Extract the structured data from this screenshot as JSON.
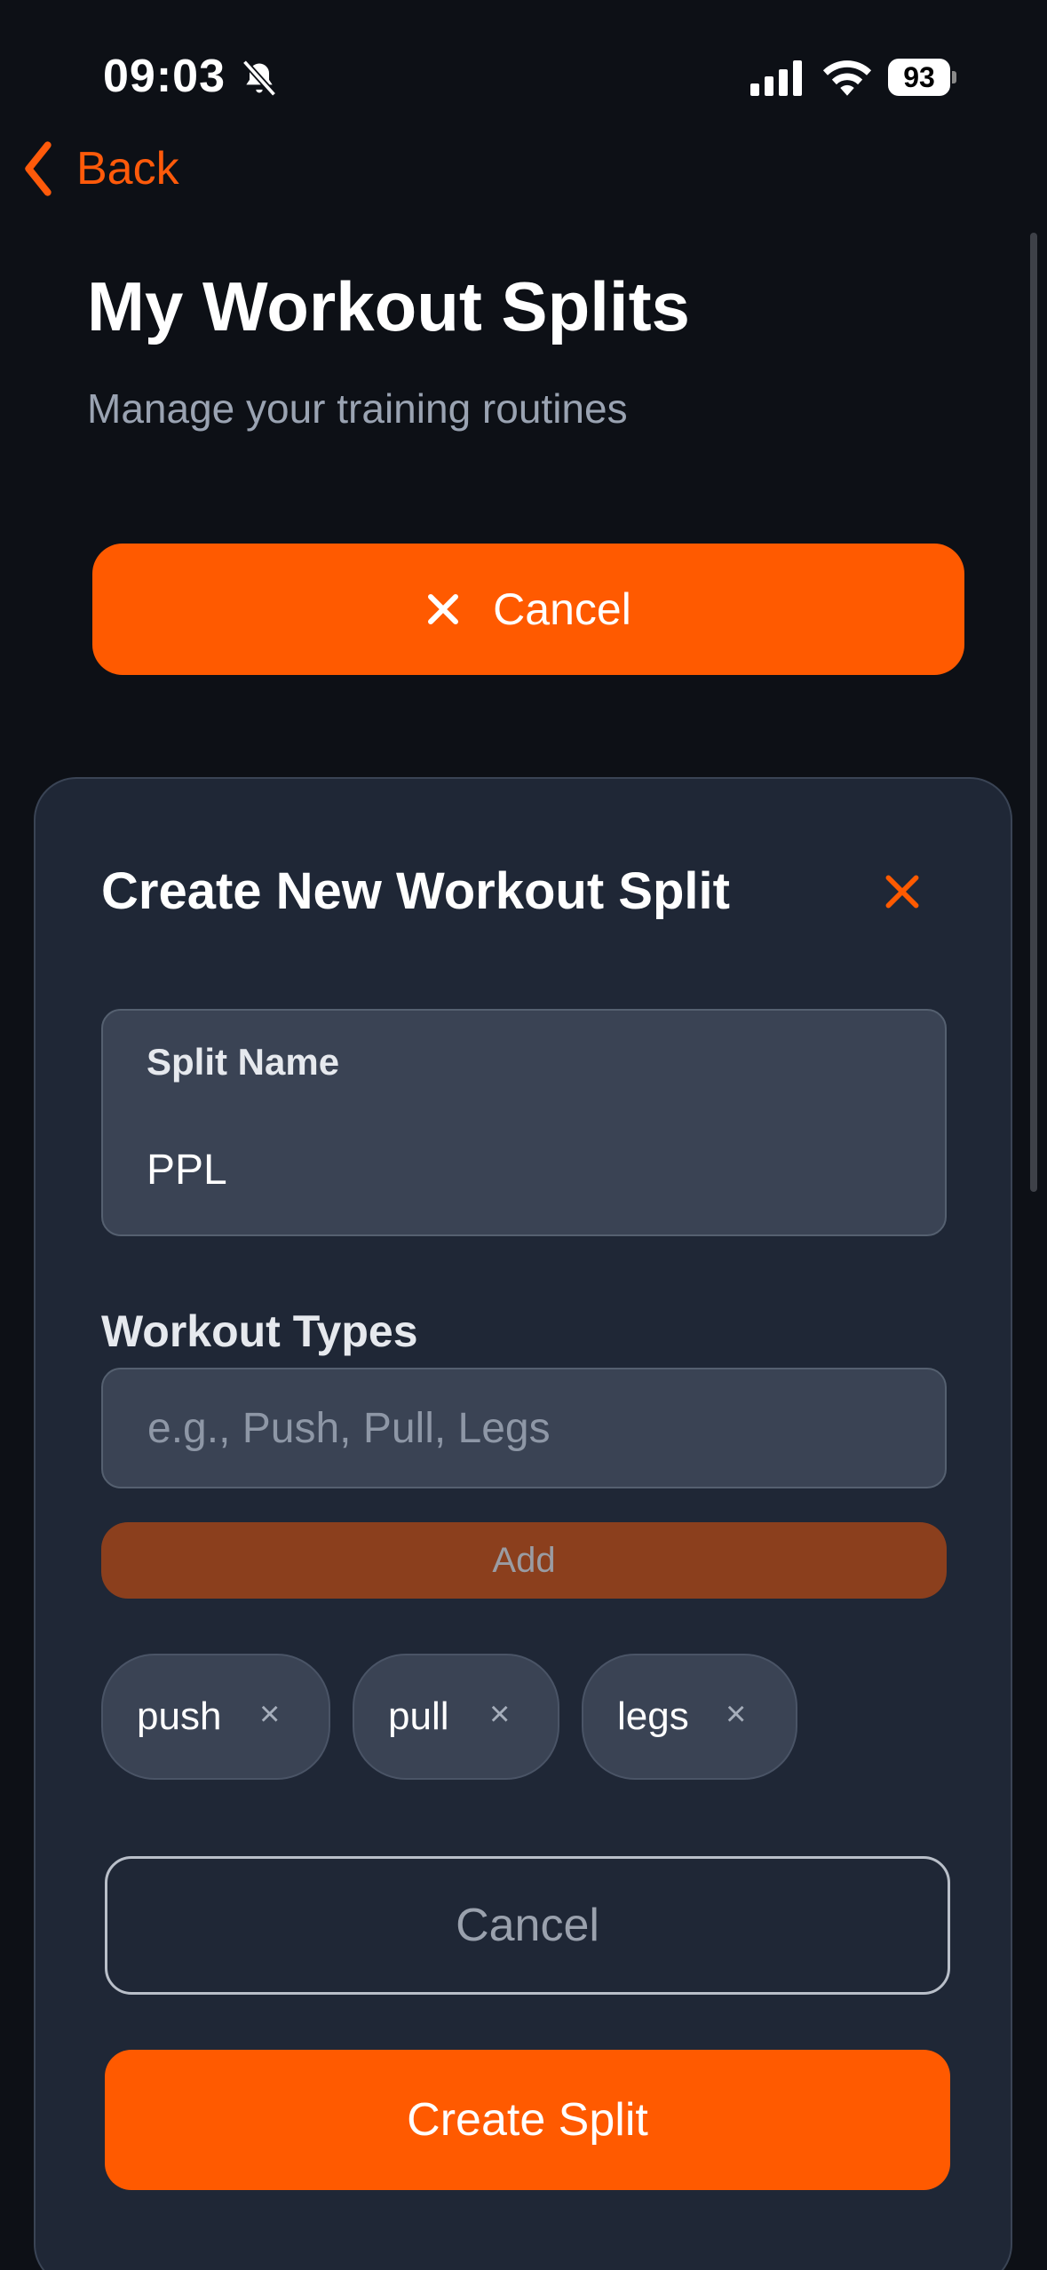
{
  "status_bar": {
    "time": "09:03",
    "battery": "93"
  },
  "nav": {
    "back_label": "Back"
  },
  "header": {
    "title": "My Workout Splits",
    "subtitle": "Manage your training routines"
  },
  "top_cancel_label": "Cancel",
  "form": {
    "title": "Create New Workout Split",
    "split_name_label": "Split Name",
    "split_name_value": "PPL",
    "workout_types_label": "Workout Types",
    "workout_types_placeholder": "e.g., Push, Pull, Legs",
    "add_label": "Add",
    "chips": [
      {
        "label": "push",
        "remove": "×"
      },
      {
        "label": "pull",
        "remove": "×"
      },
      {
        "label": "legs",
        "remove": "×"
      }
    ],
    "cancel_label": "Cancel",
    "create_label": "Create Split"
  },
  "colors": {
    "accent": "#ff5a00",
    "background": "#0d1016",
    "card": "#1f2736"
  }
}
